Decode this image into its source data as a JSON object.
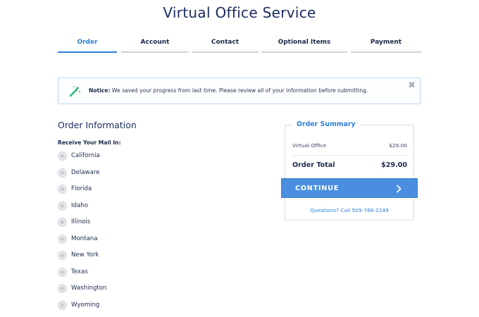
{
  "page": {
    "title": "Virtual Office Service"
  },
  "steps": [
    {
      "label": "Order",
      "active": true
    },
    {
      "label": "Account",
      "active": false
    },
    {
      "label": "Contact",
      "active": false
    },
    {
      "label": "Optional Items",
      "active": false
    },
    {
      "label": "Payment",
      "active": false
    }
  ],
  "notice": {
    "icon": "magic-wand-icon",
    "strong": "Notice:",
    "text": " We saved your progress from last time. Please review all of your information before submitting.",
    "close": "✖"
  },
  "order_info": {
    "title": "Order Information",
    "mail_label": "Receive Your Mail In:",
    "options": [
      "California",
      "Delaware",
      "Florida",
      "Idaho",
      "Illinois",
      "Montana",
      "New York",
      "Texas",
      "Washington",
      "Wyoming"
    ]
  },
  "summary": {
    "title": "Order Summary",
    "line_item": {
      "label": "Virtual Office",
      "value": "$29.00"
    },
    "total": {
      "label": "Order Total",
      "value": "$29.00"
    },
    "continue_label": "CONTINUE",
    "questions": "Questions? Call 509-768-2249"
  },
  "colors": {
    "accent": "#2f7fd6",
    "button": "#4a8fdf",
    "title": "#1a2b5e"
  }
}
